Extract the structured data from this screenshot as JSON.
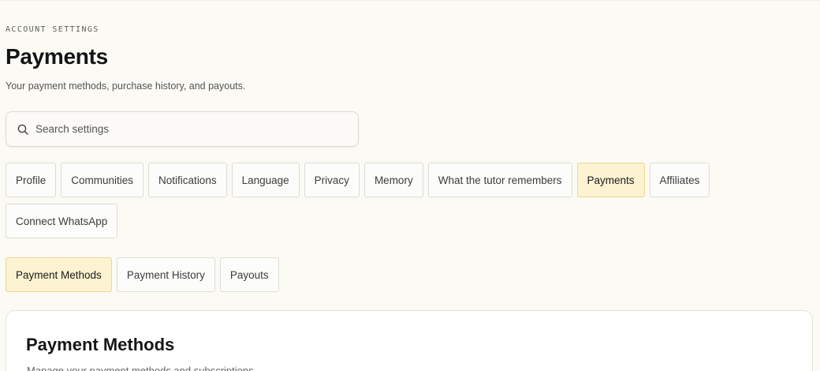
{
  "header": {
    "eyebrow": "ACCOUNT SETTINGS",
    "title": "Payments",
    "subtitle": "Your payment methods, purchase history, and payouts."
  },
  "search": {
    "placeholder": "Search settings",
    "icon": "search-icon"
  },
  "settings_tabs": [
    {
      "label": "Profile",
      "active": false
    },
    {
      "label": "Communities",
      "active": false
    },
    {
      "label": "Notifications",
      "active": false
    },
    {
      "label": "Language",
      "active": false
    },
    {
      "label": "Privacy",
      "active": false
    },
    {
      "label": "Memory",
      "active": false
    },
    {
      "label": "What the tutor remembers",
      "active": false
    },
    {
      "label": "Payments",
      "active": true
    },
    {
      "label": "Affiliates",
      "active": false
    },
    {
      "label": "Connect WhatsApp",
      "active": false
    }
  ],
  "payment_tabs": [
    {
      "label": "Payment Methods",
      "active": true
    },
    {
      "label": "Payment History",
      "active": false
    },
    {
      "label": "Payouts",
      "active": false
    }
  ],
  "card": {
    "title": "Payment Methods",
    "description": "Manage your payment methods and subscriptions."
  },
  "colors": {
    "background": "#fbfaf5",
    "active_tab_bg": "#fcf3d2",
    "active_tab_border": "#eed68d"
  }
}
